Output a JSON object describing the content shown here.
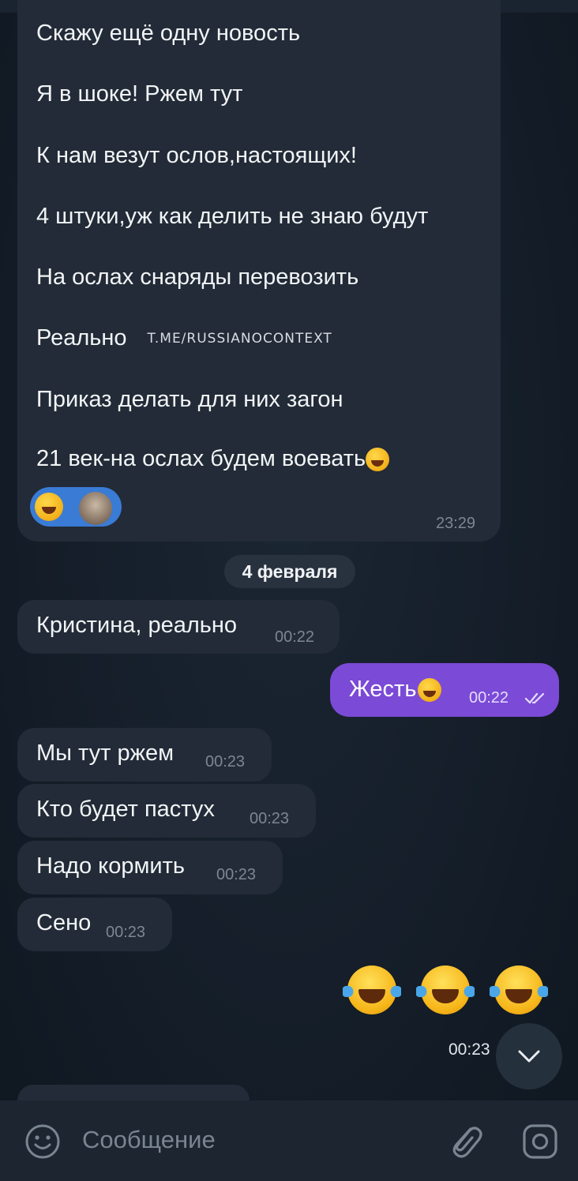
{
  "first_message": {
    "lines": [
      "Скажу ещё одну новость",
      "Я в шоке! Ржем тут",
      "К нам везут ослов,настоящих!",
      "4 штуки,уж как делить не знаю будут",
      "На ослах снаряды перевозить",
      "Реально",
      "Приказ делать для них загон",
      "21 век-на ослах будем воевать"
    ],
    "watermark": "T.ME/RUSSIANOCONTEXT",
    "time": "23:29",
    "reaction_emoji": "rolling-on-floor-laughing",
    "reaction_avatar": "user-avatar"
  },
  "date_separator": "4 февраля",
  "messages": [
    {
      "direction": "in",
      "text": "Кристина, реально",
      "time": "00:22"
    },
    {
      "direction": "out",
      "text": "Жесть",
      "time": "00:22",
      "status": "read-double-check-icon"
    },
    {
      "direction": "in",
      "text": "Мы тут ржем",
      "time": "00:23"
    },
    {
      "direction": "in",
      "text": "Кто будет пастух",
      "time": "00:23"
    },
    {
      "direction": "in",
      "text": "Надо кормить",
      "time": "00:23"
    },
    {
      "direction": "in",
      "text": "Сено",
      "time": "00:23"
    }
  ],
  "emoji_message": {
    "emojis": [
      "face-with-tears-of-joy",
      "face-with-tears-of-joy",
      "face-with-tears-of-joy"
    ],
    "time": "00:23"
  },
  "composer": {
    "placeholder": "Сообщение",
    "emoji_icon": "smile-icon",
    "attach_icon": "paperclip-icon",
    "camera_icon": "camera-icon"
  },
  "scroll_down_icon": "chevron-down-icon",
  "colors": {
    "background": "#141d28",
    "incoming_bubble": "#222b37",
    "outgoing_bubble": "#7b4ad6",
    "reaction_pill": "#3a7bd5"
  }
}
